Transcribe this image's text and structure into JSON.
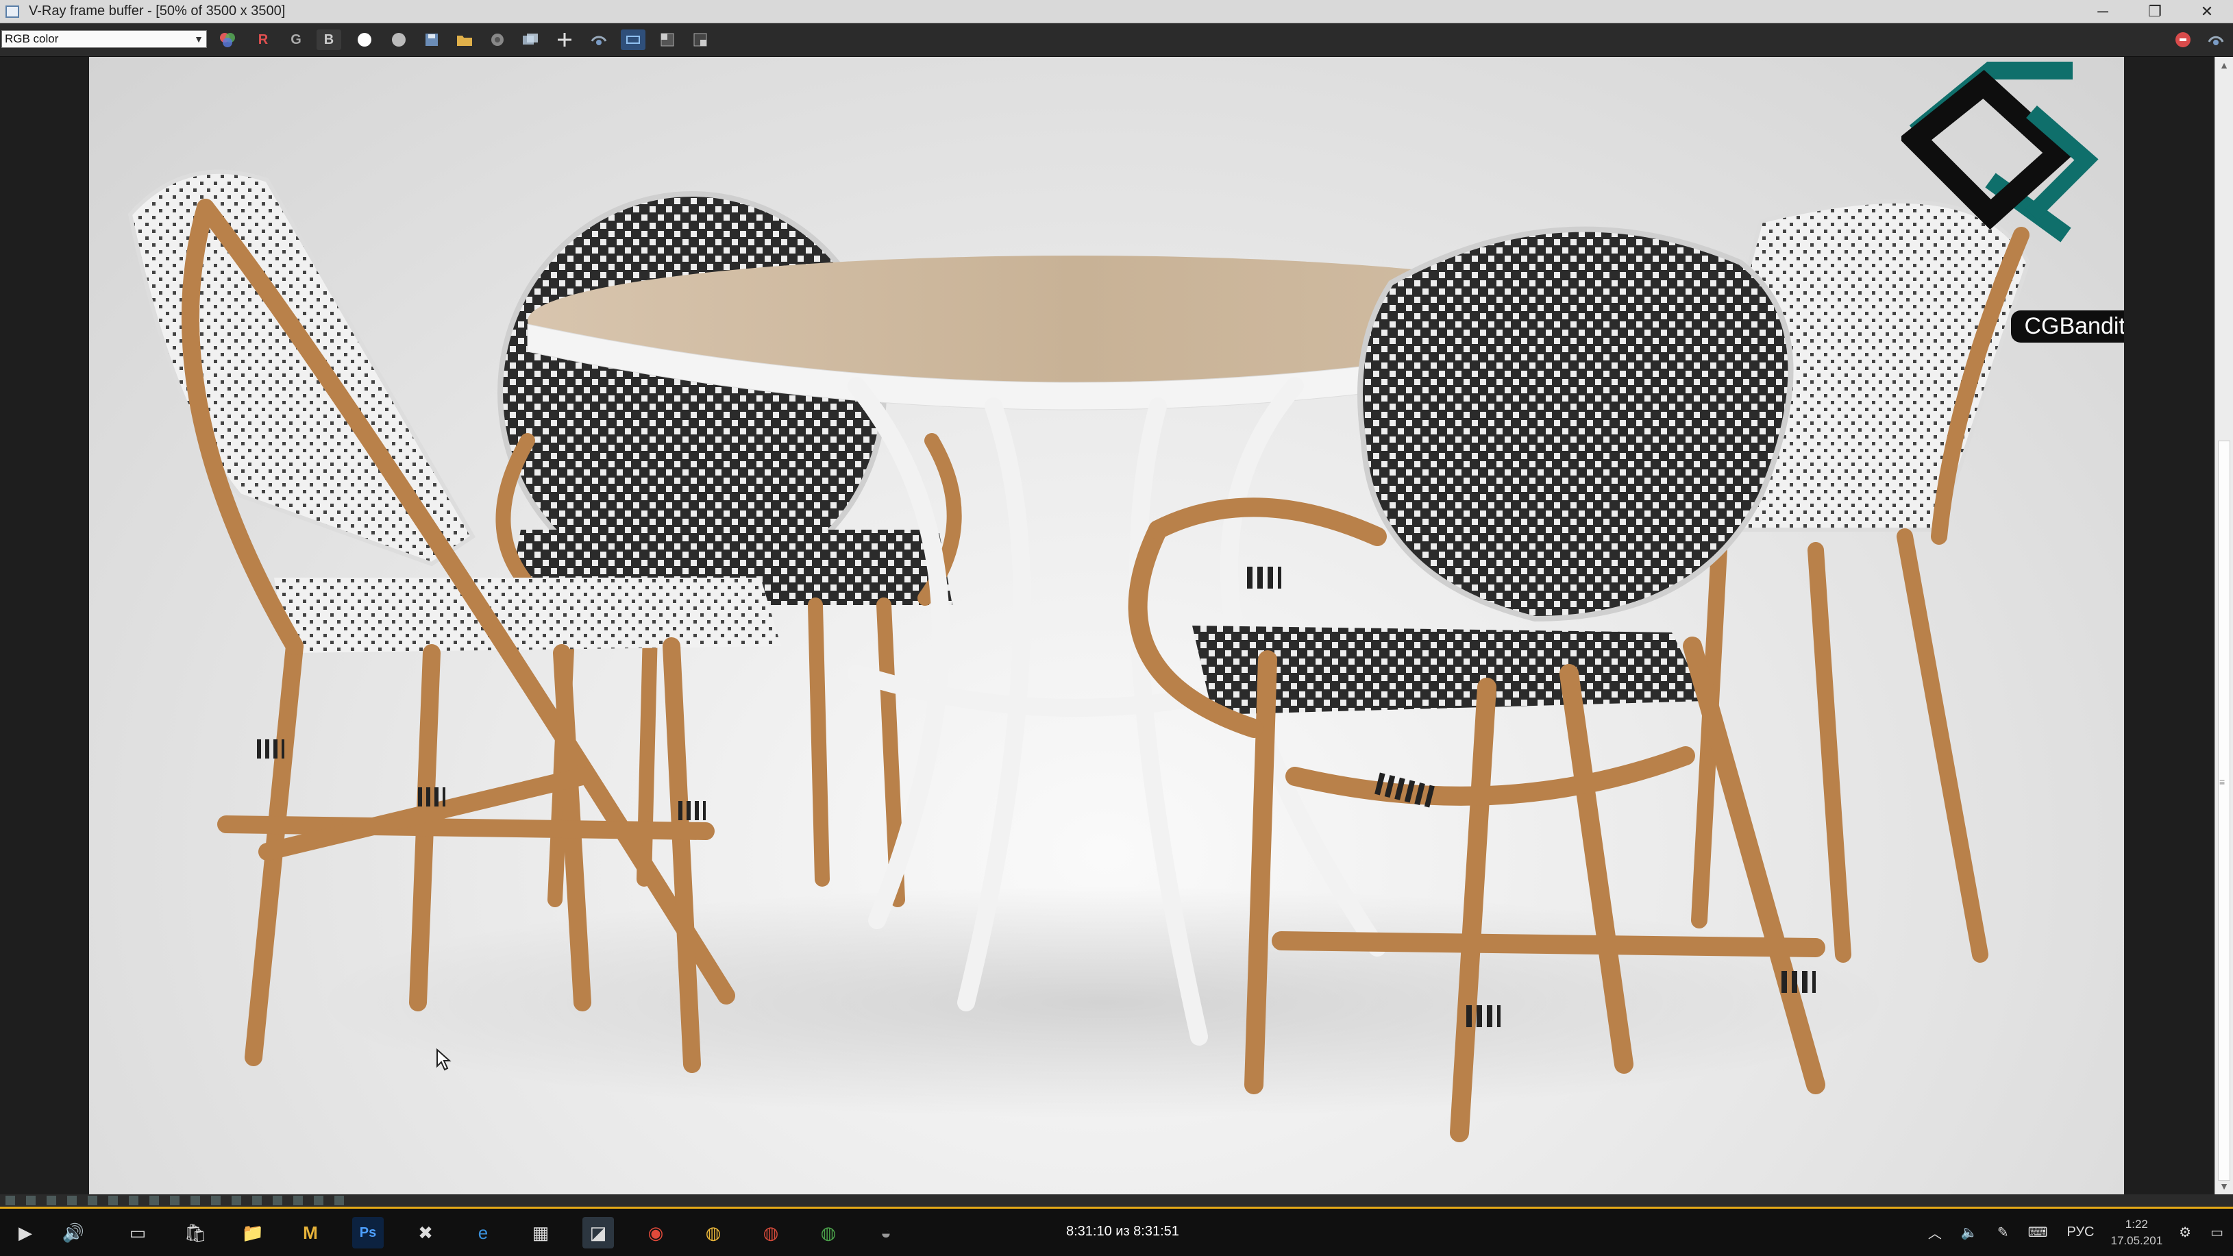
{
  "window": {
    "title": "V-Ray frame buffer - [50% of 3500 x 3500]",
    "minimize_glyph": "─",
    "restore_glyph": "❐",
    "close_glyph": "✕"
  },
  "toolbar": {
    "channel": "RGB color",
    "red_label": "R",
    "green_label": "G",
    "blue_label": "B",
    "icons": [
      "color-correction-icon",
      "red-channel",
      "green-channel",
      "blue-channel",
      "alpha-white-icon",
      "mono-icon",
      "save-icon",
      "open-icon",
      "clear-icon",
      "duplicate-icon",
      "track-mouse-icon",
      "region-render-icon",
      "link-icon",
      "compare-icon",
      "lens-effects-icon",
      "stop-render-icon",
      "render-settings-icon"
    ]
  },
  "render": {
    "logo_text": "CGBandit.com",
    "colors": {
      "teal": "#0f6f6b",
      "rattan": "#b9814a",
      "weave_dark": "#2a2a2a",
      "table_top": "#cdb79f"
    }
  },
  "taskbar": {
    "player_time": "8:31:10 из 8:31:51",
    "language": "РУС",
    "time": "1:22",
    "date": "17.05.201",
    "apps": [
      "start-icon",
      "volume-icon",
      "task-view-icon",
      "store-icon",
      "explorer-icon",
      "gmail-icon",
      "photoshop-icon",
      "3dsmax-icon",
      "edge-icon",
      "calculator-icon",
      "vray-icon",
      "record-icon",
      "chrome-canary-icon",
      "chrome-icon",
      "xbox-icon",
      "settings-icon"
    ]
  }
}
